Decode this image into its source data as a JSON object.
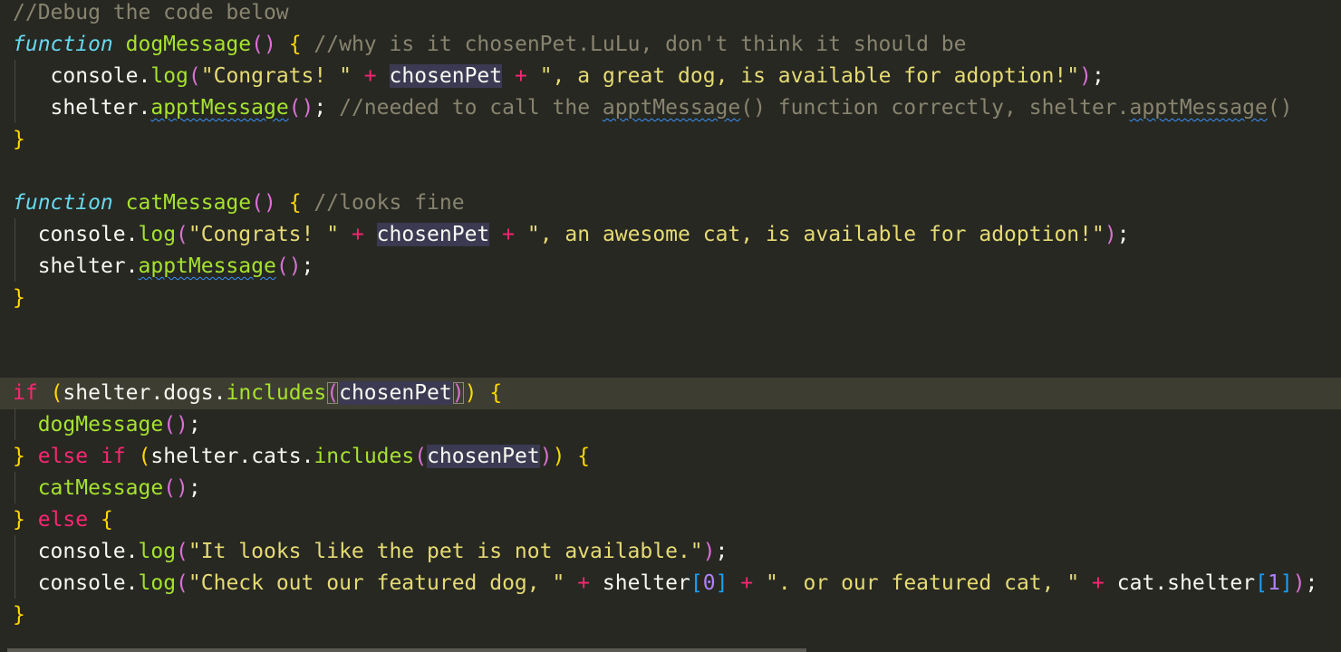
{
  "editor": {
    "lines": [
      [
        [
          "//Debug the code below",
          "comment"
        ]
      ],
      [
        [
          "function",
          "storage"
        ],
        [
          " ",
          "plain"
        ],
        [
          "dogMessage",
          "fn"
        ],
        [
          "(",
          "bracket-p"
        ],
        [
          ")",
          "bracket-p"
        ],
        [
          " ",
          "plain"
        ],
        [
          "{",
          "bracket-y"
        ],
        [
          " ",
          "plain"
        ],
        [
          "//why is it chosenPet.LuLu, don't think it should be",
          "comment"
        ]
      ],
      [
        [
          "   ",
          "plain"
        ],
        [
          "console",
          "plain"
        ],
        [
          ".",
          "plain"
        ],
        [
          "log",
          "fn"
        ],
        [
          "(",
          "bracket-p"
        ],
        [
          "\"Congrats! \"",
          "string"
        ],
        [
          " ",
          "plain"
        ],
        [
          "+",
          "keyword"
        ],
        [
          " ",
          "plain"
        ],
        [
          "chosenPet",
          "plain hl"
        ],
        [
          " ",
          "plain"
        ],
        [
          "+",
          "keyword"
        ],
        [
          " ",
          "plain"
        ],
        [
          "\", a great dog, is available for adoption!\"",
          "string"
        ],
        [
          ")",
          "bracket-p"
        ],
        [
          ";",
          "plain"
        ]
      ],
      [
        [
          "   ",
          "plain"
        ],
        [
          "shelter",
          "plain"
        ],
        [
          ".",
          "plain"
        ],
        [
          "apptMessage",
          "fn squiggle"
        ],
        [
          "(",
          "bracket-p"
        ],
        [
          ")",
          "bracket-p"
        ],
        [
          ";",
          "plain"
        ],
        [
          " ",
          "plain"
        ],
        [
          "//needed to call the ",
          "comment"
        ],
        [
          "apptMessage",
          "comment squiggle"
        ],
        [
          "() function correctly, shelter.",
          "comment"
        ],
        [
          "apptMessage",
          "comment squiggle"
        ],
        [
          "()",
          "comment"
        ]
      ],
      [
        [
          "}",
          "bracket-y"
        ]
      ],
      [],
      [
        [
          "function",
          "storage"
        ],
        [
          " ",
          "plain"
        ],
        [
          "catMessage",
          "fn"
        ],
        [
          "(",
          "bracket-p"
        ],
        [
          ")",
          "bracket-p"
        ],
        [
          " ",
          "plain"
        ],
        [
          "{",
          "bracket-y"
        ],
        [
          " ",
          "plain"
        ],
        [
          "//looks fine",
          "comment"
        ]
      ],
      [
        [
          "  ",
          "plain"
        ],
        [
          "console",
          "plain"
        ],
        [
          ".",
          "plain"
        ],
        [
          "log",
          "fn"
        ],
        [
          "(",
          "bracket-p"
        ],
        [
          "\"Congrats! \"",
          "string"
        ],
        [
          " ",
          "plain"
        ],
        [
          "+",
          "keyword"
        ],
        [
          " ",
          "plain"
        ],
        [
          "chosenPet",
          "plain hl"
        ],
        [
          " ",
          "plain"
        ],
        [
          "+",
          "keyword"
        ],
        [
          " ",
          "plain"
        ],
        [
          "\", an awesome cat, is available for adoption!\"",
          "string"
        ],
        [
          ")",
          "bracket-p"
        ],
        [
          ";",
          "plain"
        ]
      ],
      [
        [
          "  ",
          "plain"
        ],
        [
          "shelter",
          "plain"
        ],
        [
          ".",
          "plain"
        ],
        [
          "apptMessage",
          "fn squiggle"
        ],
        [
          "(",
          "bracket-p"
        ],
        [
          ")",
          "bracket-p"
        ],
        [
          ";",
          "plain"
        ]
      ],
      [
        [
          "}",
          "bracket-y"
        ]
      ],
      [],
      [],
      [
        [
          "if",
          "keyword"
        ],
        [
          " ",
          "plain"
        ],
        [
          "(",
          "bracket-y"
        ],
        [
          "shelter",
          "plain"
        ],
        [
          ".",
          "plain"
        ],
        [
          "dogs",
          "plain"
        ],
        [
          ".",
          "plain"
        ],
        [
          "includes",
          "fn"
        ],
        [
          "(",
          "bracket-p box"
        ],
        [
          "chosenPet",
          "plain hl"
        ],
        [
          ")",
          "bracket-p box"
        ],
        [
          ")",
          "bracket-y"
        ],
        [
          " ",
          "plain"
        ],
        [
          "{",
          "bracket-y"
        ]
      ],
      [
        [
          "  ",
          "plain"
        ],
        [
          "dogMessage",
          "fn"
        ],
        [
          "(",
          "bracket-p"
        ],
        [
          ")",
          "bracket-p"
        ],
        [
          ";",
          "plain"
        ]
      ],
      [
        [
          "}",
          "bracket-y"
        ],
        [
          " ",
          "plain"
        ],
        [
          "else",
          "keyword"
        ],
        [
          " ",
          "plain"
        ],
        [
          "if",
          "keyword"
        ],
        [
          " ",
          "plain"
        ],
        [
          "(",
          "bracket-y"
        ],
        [
          "shelter",
          "plain"
        ],
        [
          ".",
          "plain"
        ],
        [
          "cats",
          "plain"
        ],
        [
          ".",
          "plain"
        ],
        [
          "includes",
          "fn"
        ],
        [
          "(",
          "bracket-p"
        ],
        [
          "chosenPet",
          "plain hl"
        ],
        [
          ")",
          "bracket-p"
        ],
        [
          ")",
          "bracket-y"
        ],
        [
          " ",
          "plain"
        ],
        [
          "{",
          "bracket-y"
        ]
      ],
      [
        [
          "  ",
          "plain"
        ],
        [
          "catMessage",
          "fn"
        ],
        [
          "(",
          "bracket-p"
        ],
        [
          ")",
          "bracket-p"
        ],
        [
          ";",
          "plain"
        ]
      ],
      [
        [
          "}",
          "bracket-y"
        ],
        [
          " ",
          "plain"
        ],
        [
          "else",
          "keyword"
        ],
        [
          " ",
          "plain"
        ],
        [
          "{",
          "bracket-y"
        ]
      ],
      [
        [
          "  ",
          "plain"
        ],
        [
          "console",
          "plain"
        ],
        [
          ".",
          "plain"
        ],
        [
          "log",
          "fn"
        ],
        [
          "(",
          "bracket-p"
        ],
        [
          "\"It looks like the pet is not available.\"",
          "string"
        ],
        [
          ")",
          "bracket-p"
        ],
        [
          ";",
          "plain"
        ]
      ],
      [
        [
          "  ",
          "plain"
        ],
        [
          "console",
          "plain"
        ],
        [
          ".",
          "plain"
        ],
        [
          "log",
          "fn"
        ],
        [
          "(",
          "bracket-p"
        ],
        [
          "\"Check out our featured dog, \"",
          "string"
        ],
        [
          " ",
          "plain"
        ],
        [
          "+",
          "keyword"
        ],
        [
          " ",
          "plain"
        ],
        [
          "shelter",
          "plain"
        ],
        [
          "[",
          "bracket-b"
        ],
        [
          "0",
          "num"
        ],
        [
          "]",
          "bracket-b"
        ],
        [
          " ",
          "plain"
        ],
        [
          "+",
          "keyword"
        ],
        [
          " ",
          "plain"
        ],
        [
          "\". or our featured cat, \"",
          "string"
        ],
        [
          " ",
          "plain"
        ],
        [
          "+",
          "keyword"
        ],
        [
          " ",
          "plain"
        ],
        [
          "cat",
          "plain"
        ],
        [
          ".",
          "plain"
        ],
        [
          "shelter",
          "plain"
        ],
        [
          "[",
          "bracket-b"
        ],
        [
          "1",
          "num"
        ],
        [
          "]",
          "bracket-b"
        ],
        [
          ")",
          "bracket-p"
        ],
        [
          ";",
          "plain"
        ]
      ],
      [
        [
          "}",
          "bracket-y"
        ]
      ]
    ]
  }
}
